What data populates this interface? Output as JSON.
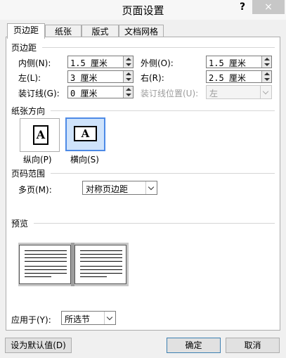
{
  "window": {
    "title": "页面设置",
    "help": "?",
    "close": "×"
  },
  "tabs": [
    {
      "label": "页边距",
      "active": true
    },
    {
      "label": "纸张",
      "active": false
    },
    {
      "label": "版式",
      "active": false
    },
    {
      "label": "文档网格",
      "active": false
    }
  ],
  "margins": {
    "section": "页边距",
    "inner_label": "内侧(N):",
    "inner_value": "1.5 厘米",
    "outer_label": "外侧(O):",
    "outer_value": "1.5 厘米",
    "left_label": "左(L):",
    "left_value": "3 厘米",
    "right_label": "右(R):",
    "right_value": "2.5 厘米",
    "gutter_label": "装订线(G):",
    "gutter_value": "0 厘米",
    "gutter_pos_label": "装订线位置(U):",
    "gutter_pos_value": "左"
  },
  "orientation": {
    "section": "纸张方向",
    "portrait_label": "纵向(P)",
    "landscape_label": "横向(S)",
    "glyph": "A",
    "selected": "landscape"
  },
  "pages": {
    "section": "页码范围",
    "multiple_label": "多页(M):",
    "multiple_value": "对称页边距"
  },
  "preview": {
    "section": "预览"
  },
  "apply": {
    "label": "应用于(Y):",
    "value": "所选节"
  },
  "buttons": {
    "set_default": "设为默认值(D)",
    "ok": "确定",
    "cancel": "取消"
  }
}
